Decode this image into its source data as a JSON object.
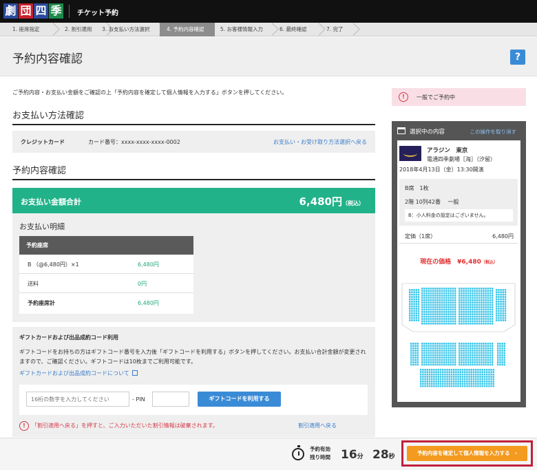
{
  "header": {
    "logo_chars": [
      "劇",
      "団",
      "四",
      "季"
    ],
    "app_title": "チケット予約"
  },
  "steps": [
    {
      "label": "1. 座席指定"
    },
    {
      "label": "2. 割引適用"
    },
    {
      "label": "3. お支払い方法選択"
    },
    {
      "label": "4. 予約内容確認"
    },
    {
      "label": "5. お客様情報入力"
    },
    {
      "label": "6. 最終確認"
    },
    {
      "label": "7. 完了"
    }
  ],
  "page": {
    "title": "予約内容確認",
    "help_label": "?",
    "intro": "ご予約内容・お支払い金額をご確認の上「予約内容を確定して個人情報を入力する」ボタンを押してください。"
  },
  "payment": {
    "heading": "お支払い方法確認",
    "method": "クレジットカード",
    "card_number": "カード番号：xxxx-xxxx-xxxx-0002",
    "change_link": "お支払い・お受け取り方法選択へ戻る"
  },
  "reservation": {
    "heading": "予約内容確認",
    "total_label": "お支払い金額合計",
    "total_value": "6,480円",
    "total_tax": "（税込）",
    "detail_heading": "お支払い明細",
    "table_header": "予約座席",
    "rows": [
      {
        "label": "B （@6,480円）×1",
        "value": "6,480円"
      },
      {
        "label": "送料",
        "value": "0円"
      },
      {
        "label": "予約座席計",
        "value": "6,480円"
      }
    ]
  },
  "gift": {
    "title": "ギフトカードおよび出品成約コード利用",
    "desc": "ギフトコードをお持ちの方はギフトコード番号を入力後「ギフトコードを利用する」ボタンを押してください。お支払い合計金額が変更されますので、ご確認ください。ギフトコードは10枚までご利用可能です。",
    "about_link": "ギフトカードおよび出品成約コードについて",
    "code_placeholder": "16桁の数字を入力してください",
    "pin_label": "- PIN",
    "apply_button": "ギフトコードを利用する",
    "warn_icon": "!",
    "warning": "「割引適用へ戻る」を押すと、ご入力いただいた割引情報は破棄されます。",
    "back_link": "割引適用へ戻る"
  },
  "sidebar": {
    "notice_icon": "!",
    "notice": "一般でご予約中",
    "cart_title": "選択中の内容",
    "undo_link": "この操作を取り消す",
    "show_name": "アラジン　東京",
    "venue": "電通四季劇場［海］（汐留）",
    "date": "2018年4月13日（金）13:30開演",
    "seat_type": "B席　1枚",
    "seat_pos": "2階 10列42番　 一般",
    "note": "B：小人料金の設定はございません。",
    "price_label": "定価（1席）",
    "price_value": "6,480円",
    "now_label": "現在の価格",
    "now_value": "¥6,480",
    "now_tax": "（税込）"
  },
  "footer": {
    "timer_label_1": "予約有効",
    "timer_label_2": "残り時間",
    "minutes": "16",
    "min_unit": "分",
    "seconds": "28",
    "sec_unit": "秒",
    "cta": "予約内容を確定して個人情報を入力する",
    "cta_arrow": "›"
  },
  "colors": {
    "accent_green": "#22b28a",
    "link_blue": "#3a7bc8",
    "cta_orange": "#f39a1f",
    "seat_cyan": "#35c4e8",
    "warning_red": "#d43a4a"
  }
}
